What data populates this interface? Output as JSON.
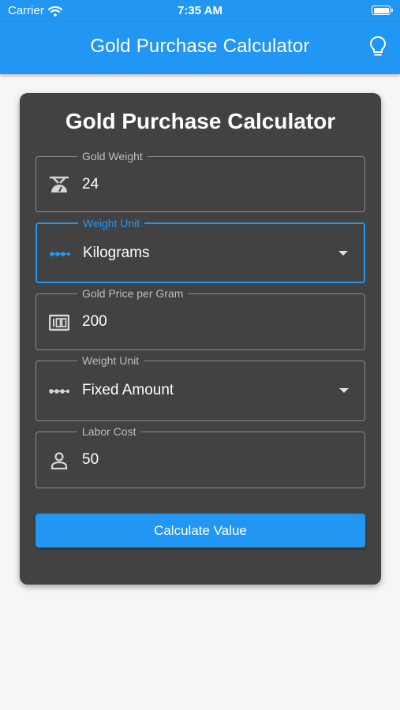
{
  "status_bar": {
    "carrier": "Carrier",
    "time": "7:35 AM"
  },
  "app_bar": {
    "title": "Gold Purchase Calculator",
    "action_icon": "lightbulb-icon"
  },
  "card": {
    "title": "Gold Purchase Calculator",
    "fields": [
      {
        "label": "Gold Weight",
        "value": "24",
        "icon": "scale-icon"
      },
      {
        "label": "Weight Unit",
        "value": "Kilograms",
        "icon": "dots-icon",
        "focused": true
      },
      {
        "label": "Gold Price per Gram",
        "value": "200",
        "icon": "price-icon"
      },
      {
        "label": "Weight Unit",
        "value": "Fixed Amount",
        "icon": "dots-icon"
      },
      {
        "label": "Labor Cost",
        "value": "50",
        "icon": "person-icon"
      }
    ],
    "button_label": "Calculate Value"
  },
  "colors": {
    "primary": "#2196f3",
    "card": "#424242",
    "background": "#f6f6f6"
  }
}
